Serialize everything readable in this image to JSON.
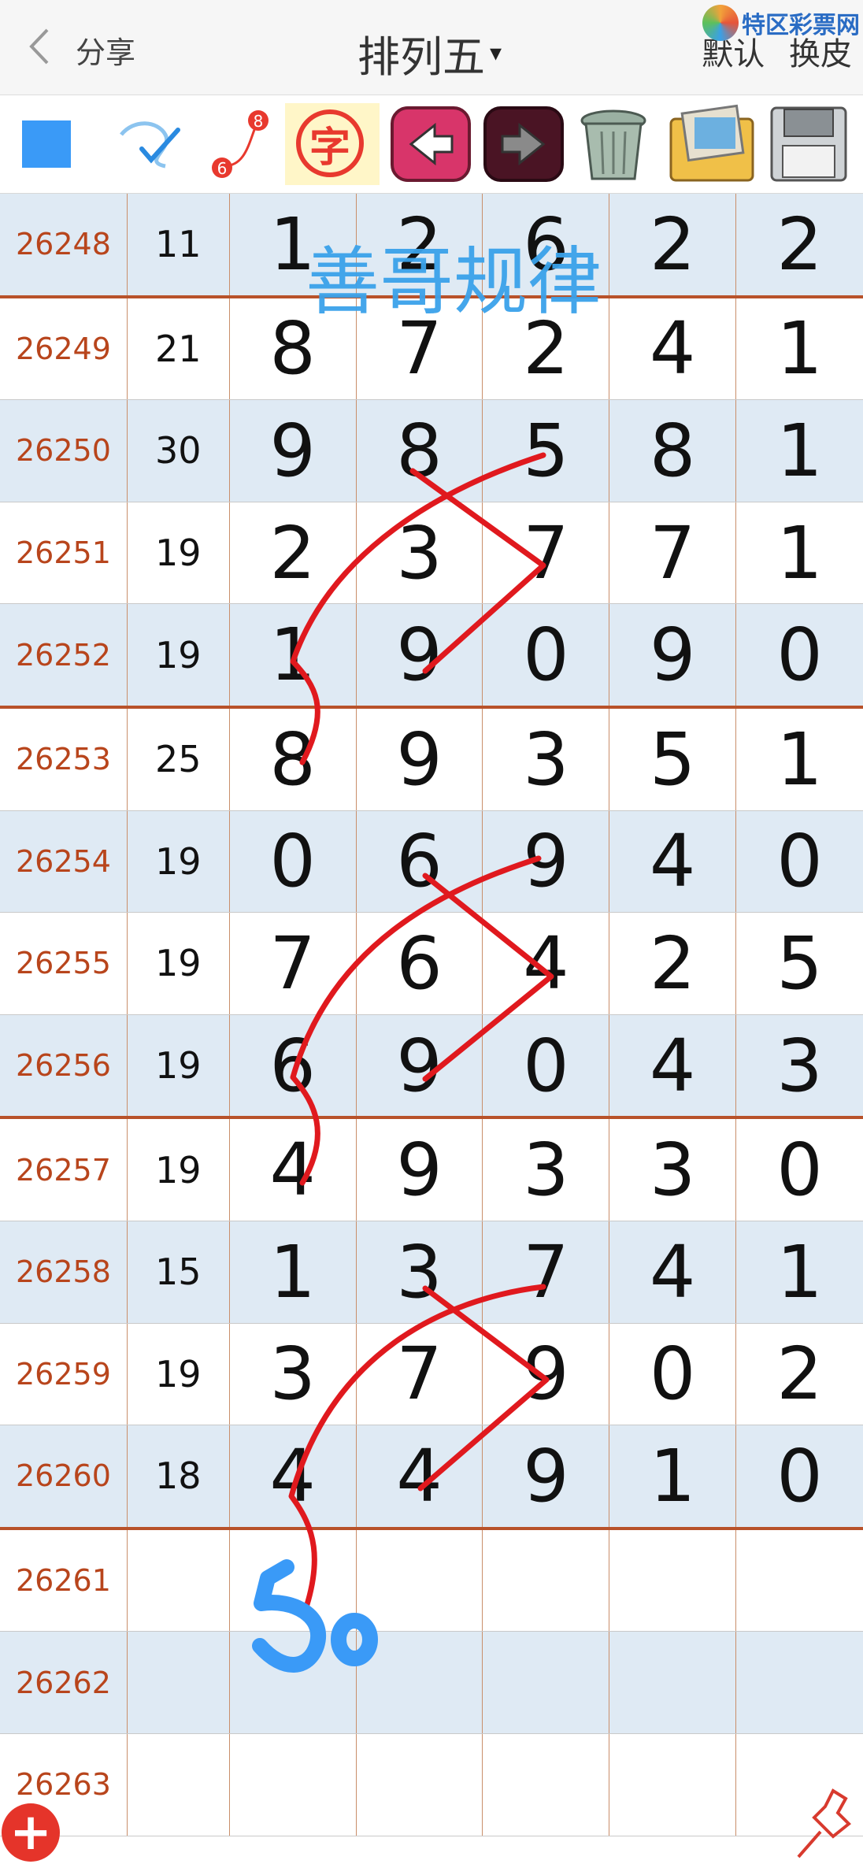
{
  "header": {
    "back_icon": "chevron-left-icon",
    "share_label": "分享",
    "title": "排列五",
    "title_caret": "▾",
    "default_label": "默认",
    "skin_label": "换皮",
    "watermark": "特区彩票网"
  },
  "toolbar": {
    "items": [
      {
        "name": "color-square",
        "color": "#3a9af7"
      },
      {
        "name": "pen-icon"
      },
      {
        "name": "number-sequence-icon",
        "label_a": "6",
        "label_b": "8"
      },
      {
        "name": "text-icon",
        "label": "字"
      },
      {
        "name": "undo-icon"
      },
      {
        "name": "redo-icon"
      },
      {
        "name": "trash-icon"
      },
      {
        "name": "photos-icon"
      },
      {
        "name": "save-icon"
      }
    ]
  },
  "overlay_text": "善哥规律",
  "handwritten_note": "5o",
  "rows": [
    {
      "issue": "26248",
      "sum": "11",
      "d": [
        "1",
        "2",
        "6",
        "2",
        "2"
      ]
    },
    {
      "issue": "26249",
      "sum": "21",
      "d": [
        "8",
        "7",
        "2",
        "4",
        "1"
      ]
    },
    {
      "issue": "26250",
      "sum": "30",
      "d": [
        "9",
        "8",
        "5",
        "8",
        "1"
      ]
    },
    {
      "issue": "26251",
      "sum": "19",
      "d": [
        "2",
        "3",
        "7",
        "7",
        "1"
      ]
    },
    {
      "issue": "26252",
      "sum": "19",
      "d": [
        "1",
        "9",
        "0",
        "9",
        "0"
      ]
    },
    {
      "issue": "26253",
      "sum": "25",
      "d": [
        "8",
        "9",
        "3",
        "5",
        "1"
      ]
    },
    {
      "issue": "26254",
      "sum": "19",
      "d": [
        "0",
        "6",
        "9",
        "4",
        "0"
      ]
    },
    {
      "issue": "26255",
      "sum": "19",
      "d": [
        "7",
        "6",
        "4",
        "2",
        "5"
      ]
    },
    {
      "issue": "26256",
      "sum": "19",
      "d": [
        "6",
        "9",
        "0",
        "4",
        "3"
      ]
    },
    {
      "issue": "26257",
      "sum": "19",
      "d": [
        "4",
        "9",
        "3",
        "3",
        "0"
      ]
    },
    {
      "issue": "26258",
      "sum": "15",
      "d": [
        "1",
        "3",
        "7",
        "4",
        "1"
      ]
    },
    {
      "issue": "26259",
      "sum": "19",
      "d": [
        "3",
        "7",
        "9",
        "0",
        "2"
      ]
    },
    {
      "issue": "26260",
      "sum": "18",
      "d": [
        "4",
        "4",
        "9",
        "1",
        "0"
      ]
    },
    {
      "issue": "26261",
      "sum": "",
      "d": [
        "",
        "",
        "",
        "",
        ""
      ]
    },
    {
      "issue": "26262",
      "sum": "",
      "d": [
        "",
        "",
        "",
        "",
        ""
      ]
    },
    {
      "issue": "26263",
      "sum": "",
      "d": [
        "",
        "",
        "",
        "",
        ""
      ]
    }
  ],
  "colors": {
    "issue_text": "#b8451c",
    "separator": "#b8522a",
    "blue_row": "#dfeaf4",
    "stroke_red": "#e0191e",
    "note_blue": "#3a9af7"
  },
  "bottom": {
    "add_icon": "plus-circle-icon",
    "pin_icon": "pin-icon"
  }
}
